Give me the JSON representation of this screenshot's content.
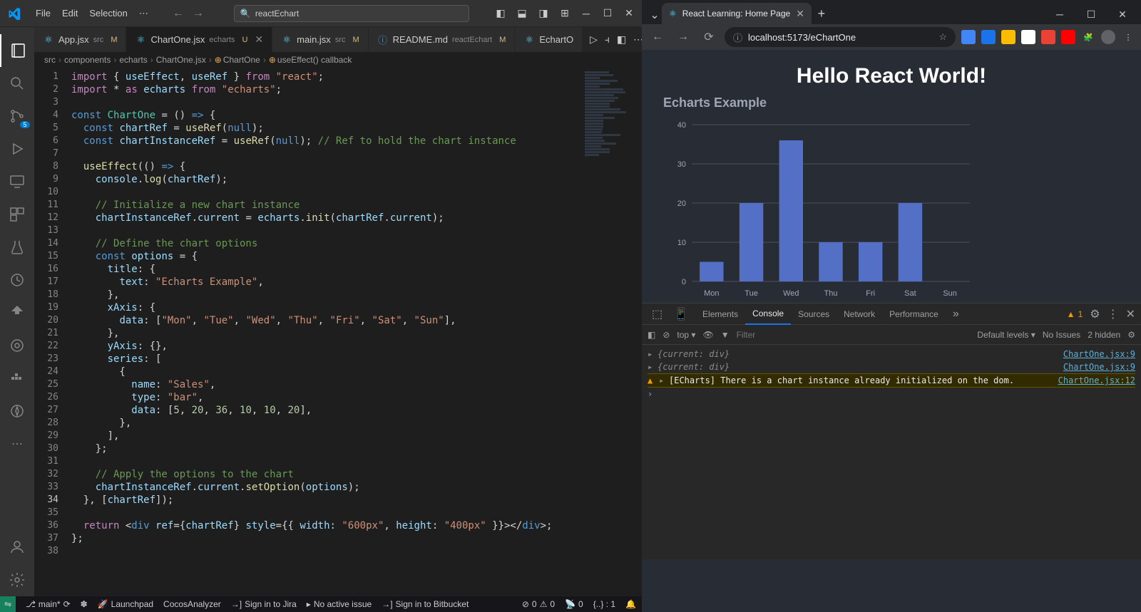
{
  "vscode": {
    "menu": [
      "File",
      "Edit",
      "Selection"
    ],
    "search": "reactEchart",
    "tabs": [
      {
        "name": "App.jsx",
        "ext": "src",
        "mod": "M",
        "active": false,
        "icon": "react"
      },
      {
        "name": "ChartOne.jsx",
        "ext": "echarts",
        "mod": "U",
        "active": true,
        "icon": "react"
      },
      {
        "name": "main.jsx",
        "ext": "src",
        "mod": "M",
        "active": false,
        "icon": "react"
      },
      {
        "name": "README.md",
        "ext": "reactEchart",
        "mod": "M",
        "active": false,
        "icon": "info"
      },
      {
        "name": "EchartO",
        "ext": "",
        "mod": "",
        "active": false,
        "icon": "react"
      }
    ],
    "breadcrumbs": [
      "src",
      "components",
      "echarts",
      "ChartOne.jsx",
      "ChartOne",
      "useEffect() callback"
    ],
    "scm_badge": "5",
    "code": [
      {
        "n": 1,
        "h": "<span class='kw'>import</span> { <span class='id'>useEffect</span>, <span class='id'>useRef</span> } <span class='kw'>from</span> <span class='str'>\"react\"</span>;"
      },
      {
        "n": 2,
        "h": "<span class='kw'>import</span> <span class='pun'>*</span> <span class='kw'>as</span> <span class='id'>echarts</span> <span class='kw'>from</span> <span class='str'>\"echarts\"</span>;"
      },
      {
        "n": 3,
        "h": ""
      },
      {
        "n": 4,
        "h": "<span class='const-kw'>const</span> <span class='typ'>ChartOne</span> = () <span class='const-kw'>=&gt;</span> {"
      },
      {
        "n": 5,
        "h": "  <span class='const-kw'>const</span> <span class='id'>chartRef</span> = <span class='fn'>useRef</span>(<span class='const-kw'>null</span>);"
      },
      {
        "n": 6,
        "h": "  <span class='const-kw'>const</span> <span class='id'>chartInstanceRef</span> = <span class='fn'>useRef</span>(<span class='const-kw'>null</span>); <span class='cmt'>// Ref to hold the chart instance</span>"
      },
      {
        "n": 7,
        "h": ""
      },
      {
        "n": 8,
        "h": "  <span class='fn'>useEffect</span>(<span class='pun'>(</span><span class='pun'>)</span> <span class='const-kw'>=&gt;</span> {"
      },
      {
        "n": 9,
        "h": "    <span class='id'>console</span>.<span class='fn'>log</span><span class='pun'>(</span><span class='id'>chartRef</span><span class='pun'>)</span>;"
      },
      {
        "n": 10,
        "h": ""
      },
      {
        "n": 11,
        "h": "    <span class='cmt'>// Initialize a new chart instance</span>"
      },
      {
        "n": 12,
        "h": "    <span class='id'>chartInstanceRef</span>.<span class='id'>current</span> = <span class='id'>echarts</span>.<span class='fn'>init</span><span class='pun'>(</span><span class='id'>chartRef</span>.<span class='id'>current</span><span class='pun'>)</span>;"
      },
      {
        "n": 13,
        "h": ""
      },
      {
        "n": 14,
        "h": "    <span class='cmt'>// Define the chart options</span>"
      },
      {
        "n": 15,
        "h": "    <span class='const-kw'>const</span> <span class='id'>options</span> = {"
      },
      {
        "n": 16,
        "h": "      <span class='id'>title</span>: {"
      },
      {
        "n": 17,
        "h": "        <span class='id'>text</span>: <span class='str'>\"Echarts Example\"</span>,"
      },
      {
        "n": 18,
        "h": "      },"
      },
      {
        "n": 19,
        "h": "      <span class='id'>xAxis</span>: {"
      },
      {
        "n": 20,
        "h": "        <span class='id'>data</span>: [<span class='str'>\"Mon\"</span>, <span class='str'>\"Tue\"</span>, <span class='str'>\"Wed\"</span>, <span class='str'>\"Thu\"</span>, <span class='str'>\"Fri\"</span>, <span class='str'>\"Sat\"</span>, <span class='str'>\"Sun\"</span>],"
      },
      {
        "n": 21,
        "h": "      },"
      },
      {
        "n": 22,
        "h": "      <span class='id'>yAxis</span>: {},"
      },
      {
        "n": 23,
        "h": "      <span class='id'>series</span>: ["
      },
      {
        "n": 24,
        "h": "        {"
      },
      {
        "n": 25,
        "h": "          <span class='id'>name</span>: <span class='str'>\"Sales\"</span>,"
      },
      {
        "n": 26,
        "h": "          <span class='id'>type</span>: <span class='str'>\"bar\"</span>,"
      },
      {
        "n": 27,
        "h": "          <span class='id'>data</span>: [<span class='num'>5</span>, <span class='num'>20</span>, <span class='num'>36</span>, <span class='num'>10</span>, <span class='num'>10</span>, <span class='num'>20</span>],"
      },
      {
        "n": 28,
        "h": "        },"
      },
      {
        "n": 29,
        "h": "      ],"
      },
      {
        "n": 30,
        "h": "    };"
      },
      {
        "n": 31,
        "h": ""
      },
      {
        "n": 32,
        "h": "    <span class='cmt'>// Apply the options to the chart</span>"
      },
      {
        "n": 33,
        "h": "    <span class='id'>chartInstanceRef</span>.<span class='id'>current</span>.<span class='fn'>setOption</span><span class='pun'>(</span><span class='id'>options</span><span class='pun'>)</span>;"
      },
      {
        "n": 34,
        "h": "  }, [<span class='id'>chartRef</span>]);"
      },
      {
        "n": 35,
        "h": ""
      },
      {
        "n": 36,
        "h": "  <span class='kw'>return</span> &lt;<span class='const-kw'>div</span> <span class='id'>ref</span>={<span class='id'>chartRef</span>} <span class='id'>style</span>={{ <span class='id'>width</span>: <span class='str'>\"600px\"</span>, <span class='id'>height</span>: <span class='str'>\"400px\"</span> }}&gt;&lt;/<span class='const-kw'>div</span>&gt;;"
      },
      {
        "n": 37,
        "h": "};"
      },
      {
        "n": 38,
        "h": ""
      }
    ],
    "current_line": 34,
    "status": {
      "branch": "main*",
      "launchpad": "Launchpad",
      "cocos": "CocosAnalyzer",
      "jira": "Sign in to Jira",
      "issue": "No active issue",
      "bitbucket": "Sign in to Bitbucket",
      "errors": "0",
      "warnings": "0",
      "ports": "0",
      "brackets": "{..} : 1"
    }
  },
  "browser": {
    "tab_title": "React Learning: Home Page",
    "url": "localhost:5173/eChartOne",
    "page_heading": "Hello React World!",
    "chart_title": "Echarts Example",
    "devtools": {
      "tabs": [
        "Elements",
        "Console",
        "Sources",
        "Network",
        "Performance"
      ],
      "active_tab": "Console",
      "warn_count": "1",
      "filter_placeholder": "Filter",
      "context": "top",
      "levels": "Default levels",
      "issues": "No Issues",
      "hidden": "2 hidden",
      "lines": [
        {
          "type": "log",
          "msg": "{current: div}",
          "src": "ChartOne.jsx:9"
        },
        {
          "type": "log",
          "msg": "{current: div}",
          "src": "ChartOne.jsx:9"
        },
        {
          "type": "warn",
          "msg": "[ECharts] There is a chart instance already initialized on the dom.",
          "src": "ChartOne.jsx:12"
        }
      ]
    }
  },
  "chart_data": {
    "type": "bar",
    "title": "Echarts Example",
    "categories": [
      "Mon",
      "Tue",
      "Wed",
      "Thu",
      "Fri",
      "Sat",
      "Sun"
    ],
    "series": [
      {
        "name": "Sales",
        "values": [
          5,
          20,
          36,
          10,
          10,
          20,
          0
        ]
      }
    ],
    "y_ticks": [
      0,
      10,
      20,
      30,
      40
    ],
    "ylim": [
      0,
      40
    ]
  }
}
